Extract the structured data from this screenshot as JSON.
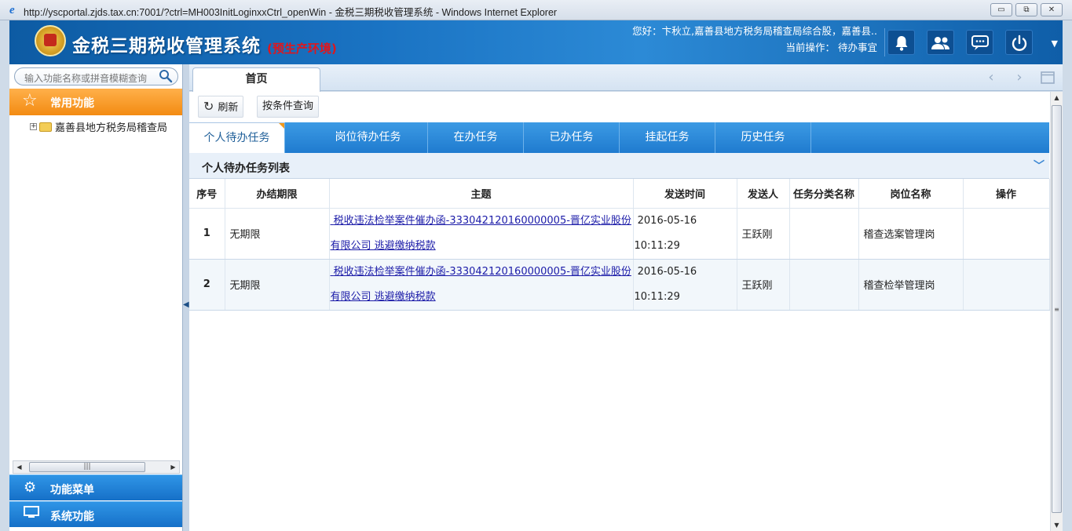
{
  "browser": {
    "window_title": "http://yscportal.zjds.tax.cn:7001/?ctrl=MH003InitLoginxxCtrl_openWin - 金税三期税收管理系统 - Windows Internet Explorer",
    "ie_icon": "e",
    "min_icon": "▭",
    "restore_icon": "⧉",
    "close_icon": "✕"
  },
  "header": {
    "app_title": "金税三期税收管理系统",
    "env_tag": "(预生产环境)",
    "greeting": "您好：卞秋立,嘉善县地方税务局稽查局综合股，嘉善县..",
    "current_op": "当前操作： 待办事宜",
    "icons": [
      "bell-icon",
      "users-icon",
      "chat-icon",
      "power-icon"
    ],
    "menu_icon": "▼"
  },
  "sidebar": {
    "search_placeholder": "输入功能名称或拼音模糊查询",
    "common_label": "常用功能",
    "tree_item": "嘉善县地方税务局稽查局",
    "nav_items": [
      {
        "label": "功能菜单",
        "icon": "gear-icon"
      },
      {
        "label": "系统功能",
        "icon": "monitor-icon"
      }
    ]
  },
  "tabs": {
    "home": "首页"
  },
  "toolbar": {
    "refresh": "刷新",
    "cond_query": "按条件查询"
  },
  "subtabs": [
    "个人待办任务",
    "岗位待办任务",
    "在办任务",
    "已办任务",
    "挂起任务",
    "历史任务"
  ],
  "list": {
    "title": "个人待办任务列表",
    "columns": [
      "序号",
      "办结期限",
      "主题",
      "发送时间",
      "发送人",
      "任务分类名称",
      "岗位名称",
      "操作"
    ],
    "rows": [
      {
        "idx": "1",
        "deadline": "无期限",
        "subject_line1": "税收违法检举案件催办函-33304212016000000​5-晋亿实业股份",
        "subject_line2": "有限公司 逃避缴纳税款",
        "time_date": "2016-05-16",
        "time_clock": "10:11:29",
        "sender": "王跃刚",
        "category": "",
        "post": "稽查选案管理岗",
        "op": ""
      },
      {
        "idx": "2",
        "deadline": "无期限",
        "subject_line1": "税收违法检举案件催办函-33304212016000000​5-晋亿实业股份",
        "subject_line2": "有限公司 逃避缴纳税款",
        "time_date": "2016-05-16",
        "time_clock": "10:11:29",
        "sender": "王跃刚",
        "category": "",
        "post": "稽查检举管理岗",
        "op": ""
      }
    ]
  }
}
